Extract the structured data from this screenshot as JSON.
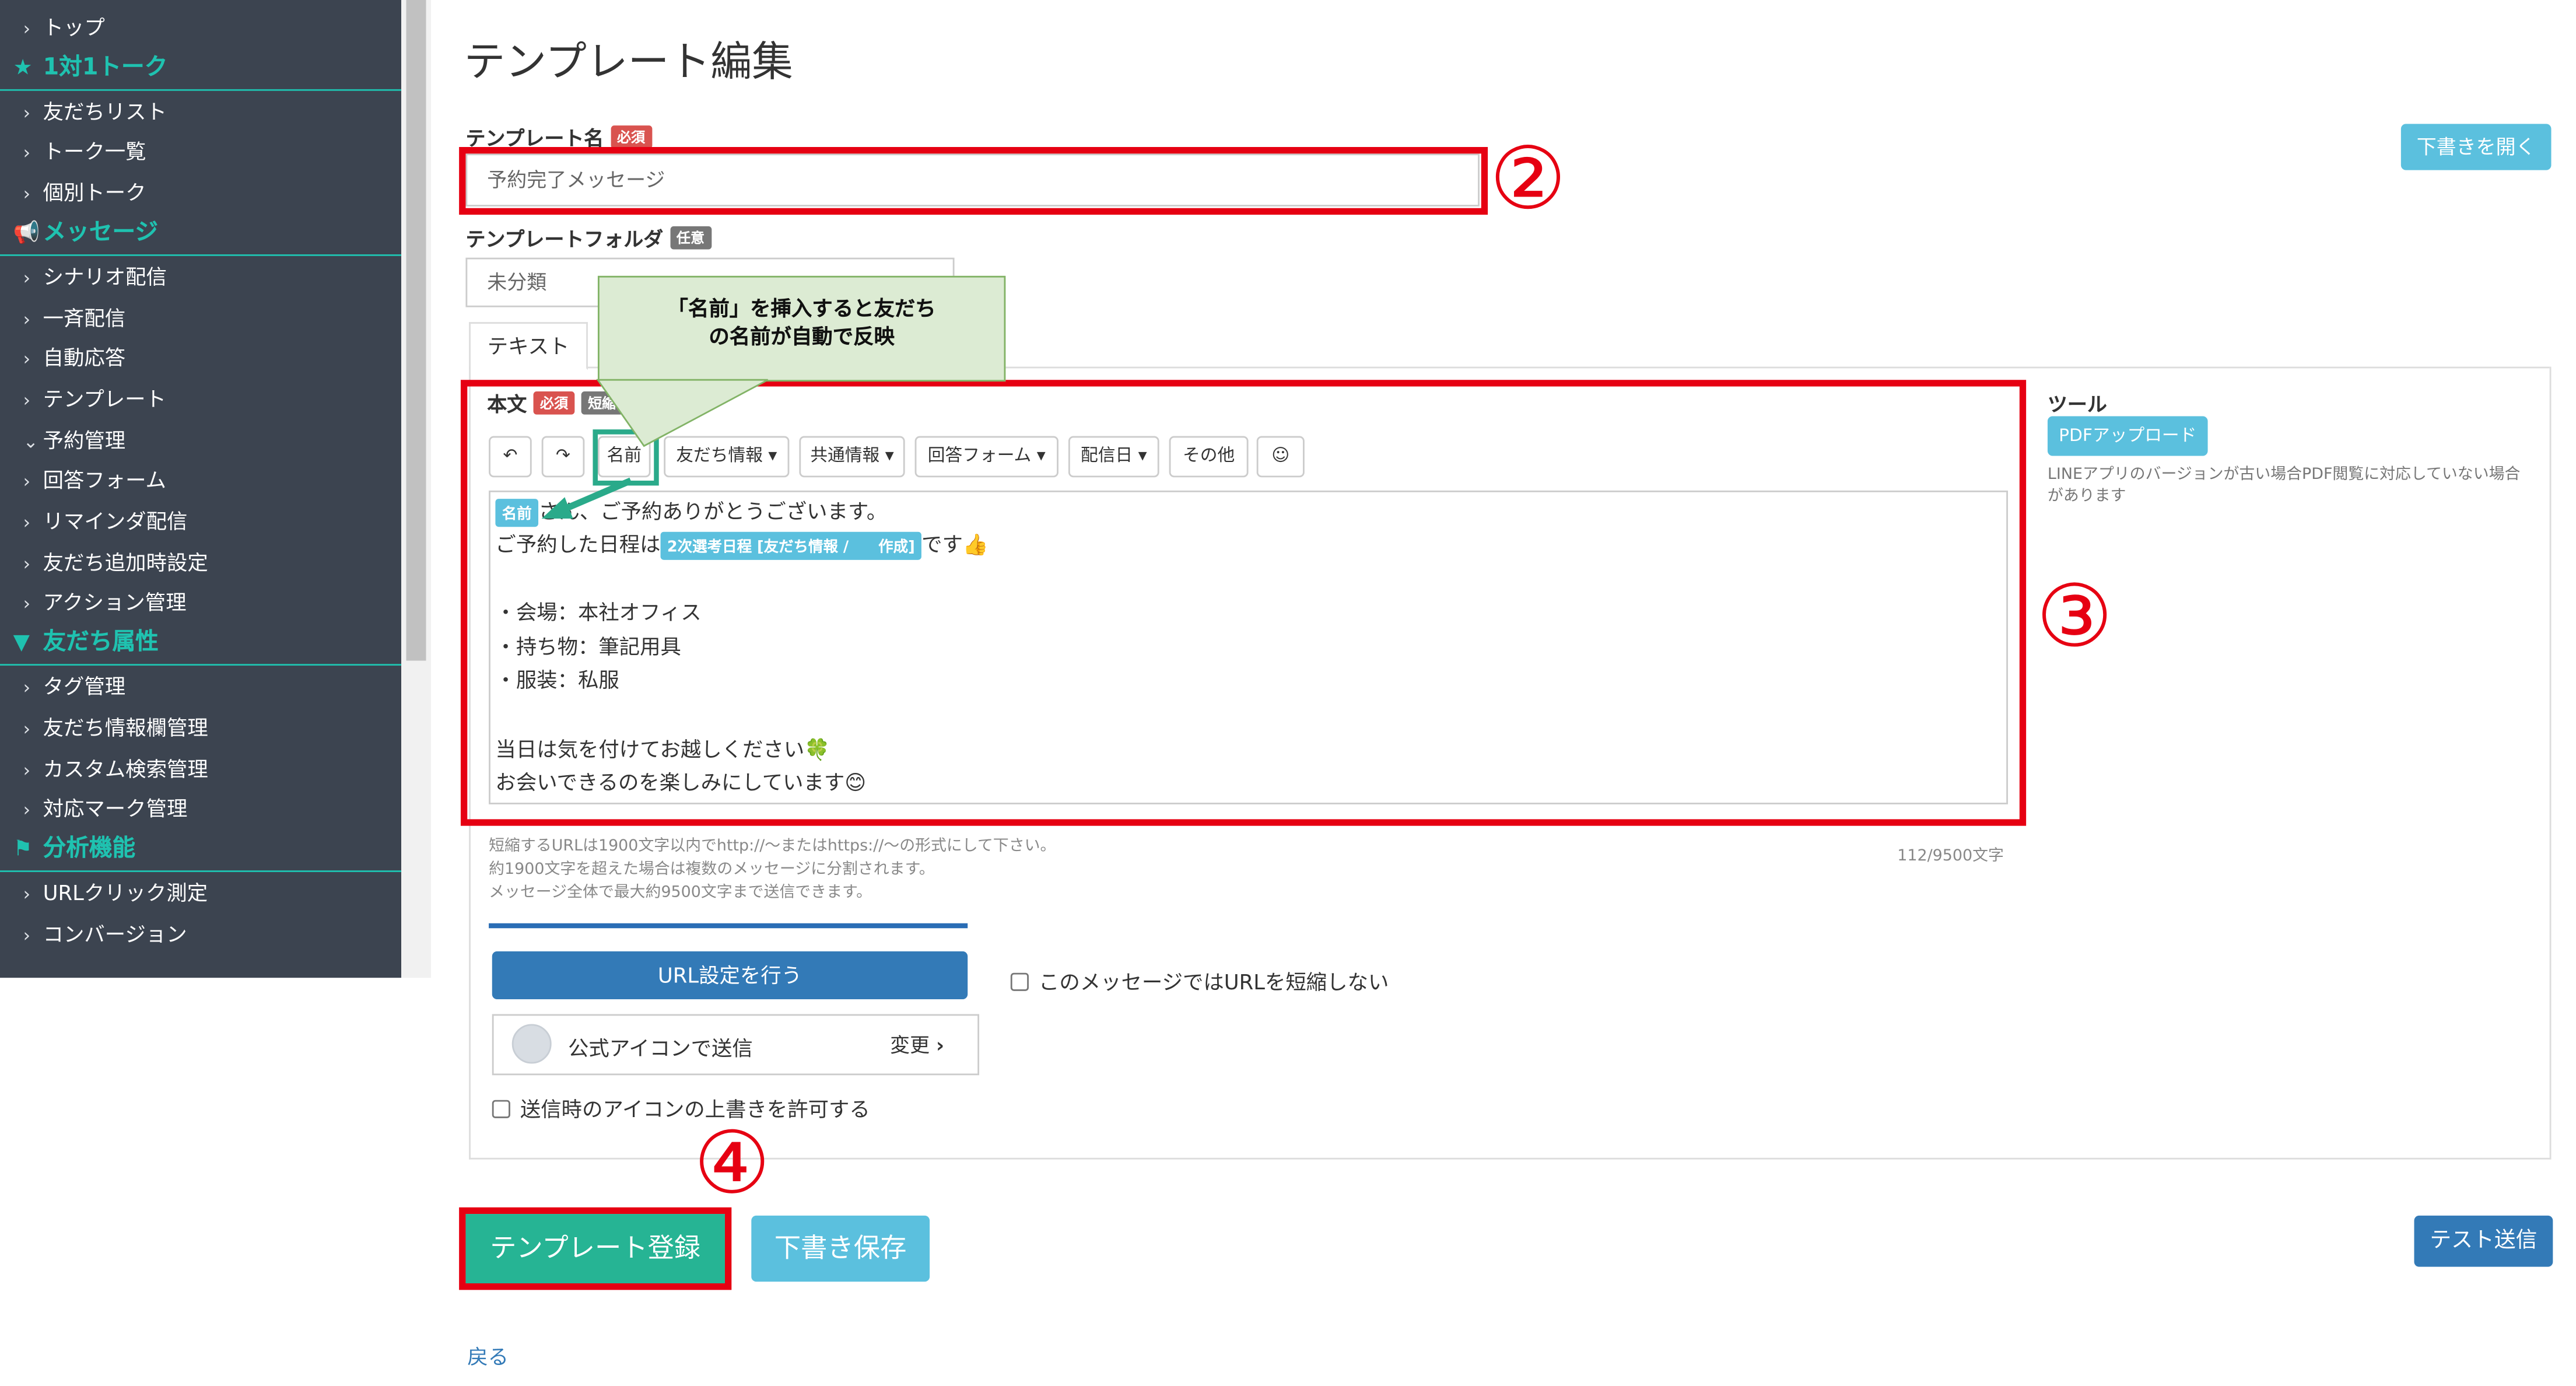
{
  "sidebar": {
    "items": [
      {
        "type": "item",
        "label": "トップ"
      },
      {
        "type": "head",
        "icon": "star-icon",
        "glyph": "★",
        "label": "1対1トーク"
      },
      {
        "type": "item",
        "label": "友だちリスト"
      },
      {
        "type": "item",
        "label": "トーク一覧"
      },
      {
        "type": "item",
        "label": "個別トーク"
      },
      {
        "type": "head",
        "icon": "megaphone-icon",
        "glyph": "📢",
        "label": "メッセージ"
      },
      {
        "type": "item",
        "label": "シナリオ配信"
      },
      {
        "type": "item",
        "label": "一斉配信"
      },
      {
        "type": "item",
        "label": "自動応答"
      },
      {
        "type": "item",
        "label": "テンプレート"
      },
      {
        "type": "item",
        "label": "予約管理",
        "expanded": true
      },
      {
        "type": "item",
        "label": "回答フォーム"
      },
      {
        "type": "item",
        "label": "リマインダ配信"
      },
      {
        "type": "item",
        "label": "友だち追加時設定"
      },
      {
        "type": "item",
        "label": "アクション管理"
      },
      {
        "type": "head",
        "icon": "filter-icon",
        "glyph": "▼",
        "label": "友だち属性"
      },
      {
        "type": "item",
        "label": "タグ管理"
      },
      {
        "type": "item",
        "label": "友だち情報欄管理"
      },
      {
        "type": "item",
        "label": "カスタム検索管理"
      },
      {
        "type": "item",
        "label": "対応マーク管理"
      },
      {
        "type": "head",
        "icon": "flag-icon",
        "glyph": "⚑",
        "label": "分析機能"
      },
      {
        "type": "item",
        "label": "URLクリック測定"
      },
      {
        "type": "item",
        "label": "コンバージョン"
      }
    ]
  },
  "page": {
    "title": "テンプレート編集",
    "draft_open_button": "下書きを開く",
    "back_link": "戻る"
  },
  "form": {
    "name_label": "テンプレート名",
    "required_badge": "必須",
    "optional_badge": "任意",
    "name_value": "予約完了メッセージ",
    "folder_label": "テンプレートフォルダ",
    "folder_value": "未分類",
    "tab_text": "テキスト",
    "body_label": "本文",
    "short_url_badge": "短縮URL",
    "toolbar": {
      "undo_icon": "undo-icon",
      "redo_icon": "redo-icon",
      "name": "名前",
      "friend_info": "友だち情報",
      "shared_info": "共通情報",
      "answer_form": "回答フォーム",
      "delivery_date": "配信日",
      "other": "その他",
      "emoji_icon": "smiley-icon"
    },
    "body": {
      "name_chip": "名前",
      "line1_suffix": "さん、ご予約ありがとうございます。",
      "line2_prefix": "ご予約した日程は",
      "line2_chip": "2次選考日程 [友だち情報 /　　作成]",
      "line2_suffix": "です👍",
      "line3": "・会場：本社オフィス",
      "line4": "・持ち物：筆記用具",
      "line5": "・服装：私服",
      "line6": "当日は気を付けてお越しください🍀",
      "line7": "お会いできるのを楽しみにしています😊"
    },
    "notes": {
      "note1": "短縮するURLは1900文字以内でhttp://〜またはhttps://〜の形式にして下さい。",
      "note2": "約1900文字を超えた場合は複数のメッセージに分割されます。",
      "note3": "メッセージ全体で最大約9500文字まで送信できます。",
      "char_count": "112/9500文字"
    },
    "url_settings_button": "URL設定を行う",
    "no_shorten_checkbox": "このメッセージではURLを短縮しない",
    "send_icon_label": "公式アイコンで送信",
    "change_link": "変更",
    "allow_icon_override": "送信時のアイコンの上書きを許可する"
  },
  "tools": {
    "heading": "ツール",
    "pdf_upload": "PDFアップロード",
    "pdf_note": "LINEアプリのバージョンが古い場合PDF閲覧に対応していない場合があります"
  },
  "actions": {
    "register": "テンプレート登録",
    "save_draft": "下書き保存",
    "test_send": "テスト送信"
  },
  "annotations": {
    "callout": "「名前」を挿入すると友だちの名前が自動で反映",
    "marker2": "②",
    "marker3": "③",
    "marker4": "④",
    "highlight_color": "#e60012",
    "callout_border": "#82b366",
    "callout_fill": "#dcebd3",
    "arrow_color": "#2aaa8a"
  }
}
